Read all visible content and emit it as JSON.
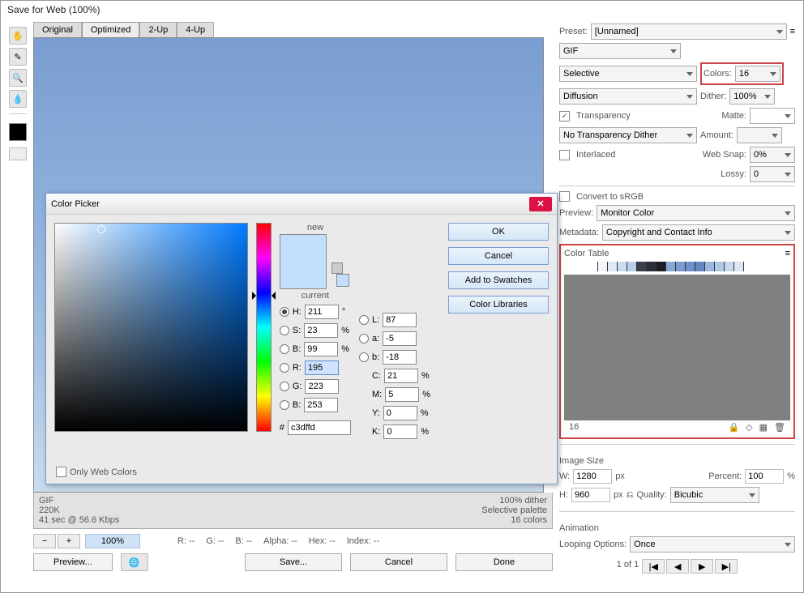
{
  "window": {
    "title": "Save for Web (100%)"
  },
  "tabs": {
    "t1": "Original",
    "t2": "Optimized",
    "t3": "2-Up",
    "t4": "4-Up"
  },
  "info": {
    "fmt": "GIF",
    "size": "220K",
    "timing": "41 sec @ 56.6 Kbps",
    "dither_pct": "100% dither",
    "palette": "Selective palette",
    "colors": "16 colors"
  },
  "zoom": {
    "value": "100%"
  },
  "readouts": {
    "r": "R: --",
    "g": "G: --",
    "b": "B: --",
    "alpha": "Alpha: --",
    "hex": "Hex: --",
    "index": "Index: --"
  },
  "bottom": {
    "preview": "Preview...",
    "save": "Save...",
    "cancel": "Cancel",
    "done": "Done"
  },
  "preset": {
    "label": "Preset:",
    "value": "[Unnamed]"
  },
  "format": {
    "value": "GIF"
  },
  "reduction": {
    "value": "Selective"
  },
  "colors": {
    "label": "Colors:",
    "value": "16"
  },
  "dither": {
    "method": "Diffusion",
    "label": "Dither:",
    "value": "100%"
  },
  "transparency": {
    "label": "Transparency",
    "matte": "Matte:"
  },
  "trans_dither": {
    "value": "No Transparency Dither",
    "amount": "Amount:"
  },
  "interlaced": {
    "label": "Interlaced",
    "websnap": "Web Snap:",
    "websnap_val": "0%"
  },
  "lossy": {
    "label": "Lossy:",
    "value": "0"
  },
  "srgb": {
    "label": "Convert to sRGB"
  },
  "preview": {
    "label": "Preview:",
    "value": "Monitor Color"
  },
  "metadata": {
    "label": "Metadata:",
    "value": "Copyright and Contact Info"
  },
  "color_table": {
    "label": "Color Table",
    "count": "16",
    "swatches": [
      "#ffffff",
      "#f2f6fb",
      "#dde9f6",
      "#c9ddf2",
      "#b7d1ed",
      "#3a3f4a",
      "#2a2e36",
      "#1b1e24",
      "#8aa8d6",
      "#7b9ccf",
      "#6f92c8",
      "#6387c0",
      "#9ab8dd",
      "#b1c8e3",
      "#c7d9ed",
      "#d9e6f4"
    ]
  },
  "image_size": {
    "label": "Image Size",
    "w_lbl": "W:",
    "w": "1280",
    "h_lbl": "H:",
    "h": "960",
    "px": "px",
    "percent_lbl": "Percent:",
    "percent": "100",
    "pct": "%",
    "quality_lbl": "Quality:",
    "quality": "Bicubic"
  },
  "animation": {
    "label": "Animation",
    "loop_lbl": "Looping Options:",
    "loop": "Once",
    "frame": "1 of 1"
  },
  "picker": {
    "title": "Color Picker",
    "new": "new",
    "current": "current",
    "ok": "OK",
    "cancel": "Cancel",
    "add": "Add to Swatches",
    "libs": "Color Libraries",
    "H": "H:",
    "Hv": "211",
    "Hd": "°",
    "S": "S:",
    "Sv": "23",
    "pct": "%",
    "B": "B:",
    "Bv": "99",
    "R": "R:",
    "Rv": "195",
    "G": "G:",
    "Gv": "223",
    "Bb": "B:",
    "Bbv": "253",
    "L": "L:",
    "Lv": "87",
    "a": "a:",
    "av": "-5",
    "b": "b:",
    "bv": "-18",
    "C": "C:",
    "Cv": "21",
    "M": "M:",
    "Mv": "5",
    "Y": "Y:",
    "Yv": "0",
    "K": "K:",
    "Kv": "0",
    "hash": "#",
    "hex": "c3dffd",
    "webonly": "Only Web Colors"
  }
}
